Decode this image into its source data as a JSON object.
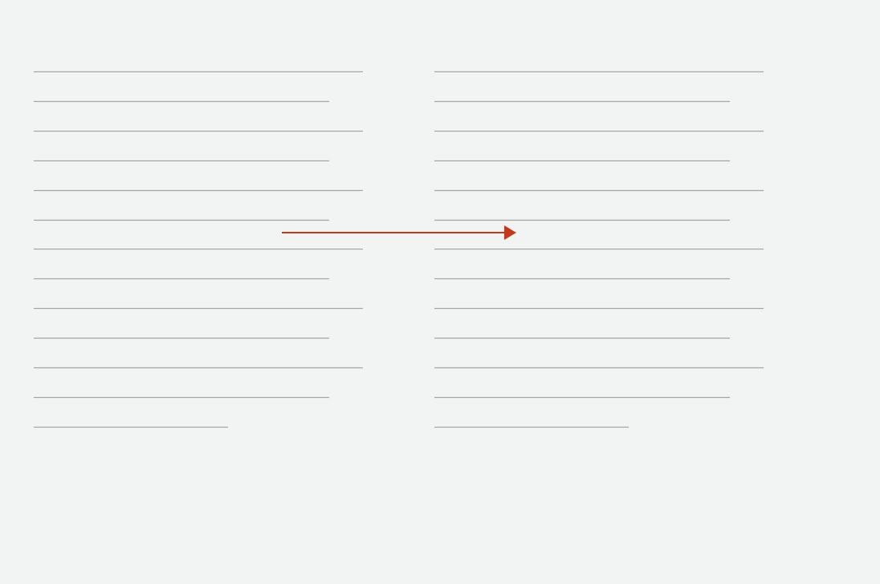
{
  "colors": {
    "background": "#f2f4f3",
    "rule_line": "#a3a6a5",
    "arrow": "#c03a1b"
  },
  "diagram": {
    "description_visible_text": "",
    "left_column": {
      "rule_count": 13,
      "pattern": [
        "long",
        "short",
        "long",
        "short",
        "long",
        "short",
        "long",
        "short",
        "long",
        "short",
        "long",
        "short",
        "final"
      ]
    },
    "right_column": {
      "rule_count": 13,
      "pattern": [
        "long",
        "short",
        "long",
        "short",
        "long",
        "short",
        "long",
        "short",
        "long",
        "short",
        "long",
        "short",
        "final"
      ]
    },
    "arrow": {
      "direction": "right",
      "from": "left-column",
      "to": "right-column"
    }
  }
}
